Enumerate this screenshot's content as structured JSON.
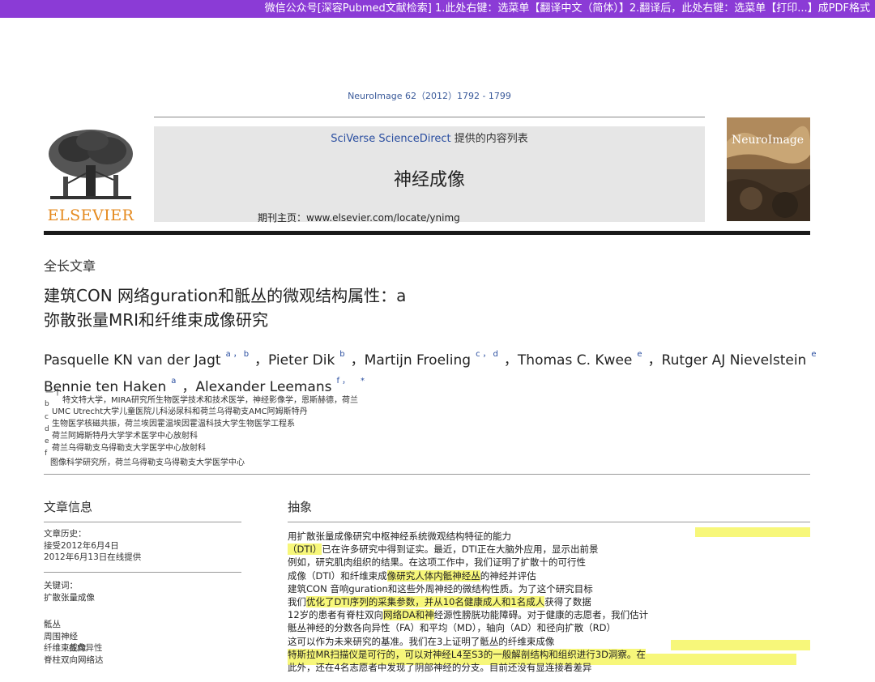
{
  "banner": {
    "text": "微信公众号[深容Pubmed文献检索] 1.此处右键：选菜单【翻译中文（简体）】2.翻译后，此处右键：选菜单【打印...】成PDF格式"
  },
  "journal_ref": "NeuroImage 62（2012）1792 - 1799",
  "header": {
    "sciverse": "SciVerse ScienceDirect",
    "provided": " 提供的内容列表",
    "journal_title": "神经成像",
    "homepage": "期刊主页：www.elsevier.com/locate/ynimg",
    "publisher_logo_text": "ELSEVIER",
    "cover_title": "NeuroImage"
  },
  "article_kind": "全长文章",
  "title_lines": [
    "建筑CON 网络guration和骶丛的微观结构属性：a",
    "弥散张量MRI和纤维束成像研究"
  ],
  "authors": {
    "line1": [
      {
        "name": "Pasquelle KN van der Jagt",
        "sup": "a，b"
      },
      {
        "name": "，Pieter Dik",
        "sup": "b"
      },
      {
        "name": "，Martijn Froeling",
        "sup": "c，d"
      },
      {
        "name": "，Thomas C. Kwee",
        "sup": "e"
      },
      {
        "name": "，Rutger AJ Nievelstein",
        "sup": "e"
      }
    ],
    "line2": [
      {
        "name": "Bennie ten Haken",
        "sup": "a"
      },
      {
        "name": "，Alexander Leemans",
        "sup": "f，"
      },
      {
        "name": "",
        "sup": "*"
      }
    ]
  },
  "affiliations": {
    "lines": [
      "一个",
      "特文特大学，MIRA研究所生物医学技术和技术医学，神经影像学，恩斯赫德，荷兰",
      "UMC Utrecht大学儿童医院儿科泌尿科和荷兰乌得勒支AMC阿姆斯特丹",
      "生物医学核磁共振，荷兰埃因霍温埃因霍温科技大学生物医学工程系",
      "荷兰阿姆斯特丹大学学术医学中心放射科",
      "荷兰乌得勒支乌得勒支大学医学中心放射科",
      "图像科学研究所，荷兰乌得勒支乌得勒支大学医学中心"
    ],
    "letters": [
      "b",
      "c",
      "d",
      "e",
      "f"
    ]
  },
  "article_info": {
    "heading": "文章信息",
    "history_label": "文章历史：",
    "received": "接受2012年6月4日",
    "online": "2012年6月13日在线提供",
    "keywords_label": "关键词：",
    "keyword1": "扩散张量成像",
    "keywords_more": [
      "骶丛",
      "周围神经",
      "纤维束成像",
      "脊柱双向网络达"
    ],
    "overlap_text": "各向异性"
  },
  "abstract": {
    "heading": "抽象",
    "lines": [
      "用扩散张量成像研究中枢神经系统微观结构特征的能力",
      "（DTI）已在许多研究中得到证实。最近，DTI正在大脑外应用，显示出前景",
      "例如，研究肌肉组织的结果。在这项工作中，我们证明了扩散十的可行性",
      "成像（DTI）和纤维束成像研究人体内骶神经丛的神经并评估",
      "建筑CON 音响guration和这些外周神经的微结构性质。为了这个研究目标",
      "我们优化了DTI序列的采集参数，并从10名健康成人和1名成人获得了数据",
      "12岁的患者有脊柱双向网络DA和神经源性膀胱功能障碍。对于健康的志愿者，我们估计",
      "骶丛神经的分数各向异性（FA）和平均（MD），轴向（AD）和径向扩散（RD）",
      "这可以作为未来研究的基准。我们在3上证明了骶丛的纤维束成像",
      "特斯拉MR扫描仪是可行的，可以对神经L4至S3的一般解剖结构和组织进行3D洞察。在",
      "此外，还在4名志愿者中发现了阴部神经的分支。目前还没有显连接着差异"
    ],
    "hl_parts": {
      "l1a": "（DTI）",
      "l1b": "已在许多研究中得到证实。最近，DTI正在大脑外应用，显示出前景",
      "l3a": "成像（DTI）和纤维束成",
      "l3b": "像研究人体内骶神经丛",
      "l3c": "的神经并评估",
      "l5a": "我们",
      "l5b": "优化了DTI序列的采集参数，并从10名健康成人和1名成人",
      "l5c": "获得了数据",
      "l6a": "12岁的患者有脊柱双向",
      "l6b": "网络DA和神",
      "l6c": "经源性膀胱功能障碍。对于健康的志愿者，我们估计",
      "l9": "特斯拉MR扫描仪是可行的，可以对神经L4至S3的一般解剖结构和组织进行3D洞察。在"
    }
  },
  "colors": {
    "banner": "#8b3bd6",
    "link": "#2a4ea0",
    "highlight": "#f7f77a",
    "elsevier": "#e58a1f"
  }
}
